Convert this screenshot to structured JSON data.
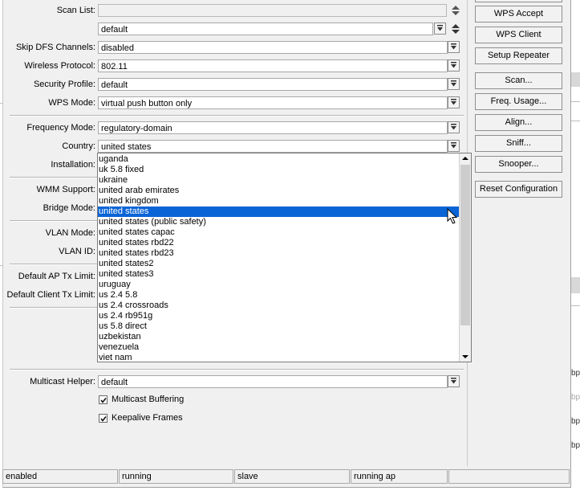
{
  "form": {
    "scan_list": {
      "label": "Scan List:",
      "value": ""
    },
    "scan_list_2": {
      "value": "default"
    },
    "skip_dfs": {
      "label": "Skip DFS Channels:",
      "value": "disabled"
    },
    "wireless_protocol": {
      "label": "Wireless Protocol:",
      "value": "802.11"
    },
    "security_profile": {
      "label": "Security Profile:",
      "value": "default"
    },
    "wps_mode": {
      "label": "WPS Mode:",
      "value": "virtual push button only"
    },
    "frequency_mode": {
      "label": "Frequency Mode:",
      "value": "regulatory-domain"
    },
    "country": {
      "label": "Country:",
      "value": "united states"
    },
    "installation": {
      "label": "Installation:"
    },
    "wmm_support": {
      "label": "WMM Support:"
    },
    "bridge_mode": {
      "label": "Bridge Mode:"
    },
    "vlan_mode": {
      "label": "VLAN Mode:"
    },
    "vlan_id": {
      "label": "VLAN ID:"
    },
    "default_ap_tx_limit": {
      "label": "Default AP Tx Limit:"
    },
    "default_client_tx_limit": {
      "label": "Default Client Tx Limit:"
    },
    "multicast_helper": {
      "label": "Multicast Helper:",
      "value": "default"
    },
    "multicast_buffering": {
      "label": "Multicast Buffering",
      "checked": true
    },
    "keepalive_frames": {
      "label": "Keepalive Frames",
      "checked": true
    }
  },
  "buttons": {
    "wps_accept": "WPS Accept",
    "wps_client": "WPS Client",
    "setup_repeater": "Setup Repeater",
    "scan": "Scan...",
    "freq_usage": "Freq. Usage...",
    "align": "Align...",
    "sniff": "Sniff...",
    "snooper": "Snooper...",
    "reset_configuration": "Reset Configuration"
  },
  "country_dropdown": {
    "selected_index": 5,
    "options": [
      "uganda",
      "uk 5.8 fixed",
      "ukraine",
      "united arab emirates",
      "united kingdom",
      "united states",
      "united states (public safety)",
      "united states capac",
      "united states rbd22",
      "united states rbd23",
      "united states2",
      "united states3",
      "uruguay",
      "us 2.4 5.8",
      "us 2.4 crossroads",
      "us 2.4 rb951g",
      "us 5.8 direct",
      "uzbekistan",
      "venezuela",
      "viet nam"
    ]
  },
  "status_bar": [
    "enabled",
    "running",
    "slave",
    "running ap",
    ""
  ],
  "background": {
    "bps_1": "bp",
    "bps_2": "bp",
    "bps_3": "bp",
    "bps_4": "bp"
  }
}
